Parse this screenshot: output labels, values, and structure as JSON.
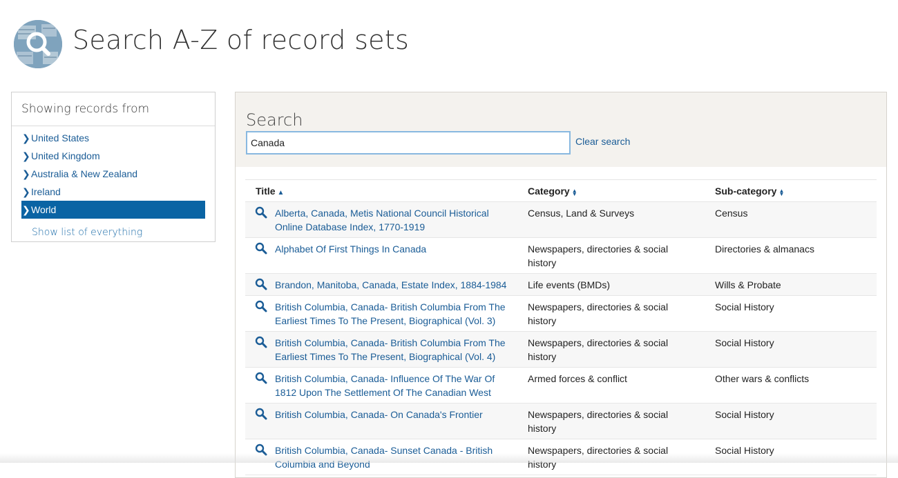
{
  "page": {
    "title": "Search A-Z of record sets"
  },
  "filter": {
    "heading": "Showing records from",
    "items": [
      {
        "label": "United States",
        "active": false
      },
      {
        "label": "United Kingdom",
        "active": false
      },
      {
        "label": "Australia & New Zealand",
        "active": false
      },
      {
        "label": "Ireland",
        "active": false
      },
      {
        "label": "World",
        "active": true
      }
    ],
    "show_all": "Show list of everything"
  },
  "search": {
    "label": "Search",
    "value": "Canada",
    "clear_label": "Clear search"
  },
  "table": {
    "columns": [
      {
        "label": "Title",
        "sort": "asc"
      },
      {
        "label": "Category",
        "sort": "both"
      },
      {
        "label": "Sub-category",
        "sort": "both"
      }
    ],
    "rows": [
      {
        "title": "Alberta, Canada, Metis National Council Historical Online Database Index, 1770-1919",
        "category": "Census, Land & Surveys",
        "subcategory": "Census"
      },
      {
        "title": "Alphabet Of First Things In Canada",
        "category": "Newspapers, directories & social history",
        "subcategory": "Directories & almanacs"
      },
      {
        "title": "Brandon, Manitoba, Canada, Estate Index, 1884-1984",
        "category": "Life events (BMDs)",
        "subcategory": "Wills & Probate"
      },
      {
        "title": "British Columbia, Canada- British Columbia From The Earliest Times To The Present, Biographical (Vol. 3)",
        "category": "Newspapers, directories & social history",
        "subcategory": "Social History"
      },
      {
        "title": "British Columbia, Canada- British Columbia From The Earliest Times To The Present, Biographical (Vol. 4)",
        "category": "Newspapers, directories & social history",
        "subcategory": "Social History"
      },
      {
        "title": "British Columbia, Canada- Influence Of The War Of 1812 Upon The Settlement Of The Canadian West",
        "category": "Armed forces & conflict",
        "subcategory": "Other wars & conflicts"
      },
      {
        "title": "British Columbia, Canada- On Canada's Frontier",
        "category": "Newspapers, directories & social history",
        "subcategory": "Social History"
      },
      {
        "title": "British Columbia, Canada- Sunset Canada - British Columbia and Beyond",
        "category": "Newspapers, directories & social history",
        "subcategory": "Social History"
      }
    ]
  },
  "icons": {
    "logo": "magnifier-over-records-logo",
    "row_icon": "search-icon",
    "nav_chevron": "chevron-right-icon"
  },
  "colors": {
    "link": "#1a5c96",
    "active_bg": "#0a64a4",
    "search_bg": "#f4f2ee"
  }
}
